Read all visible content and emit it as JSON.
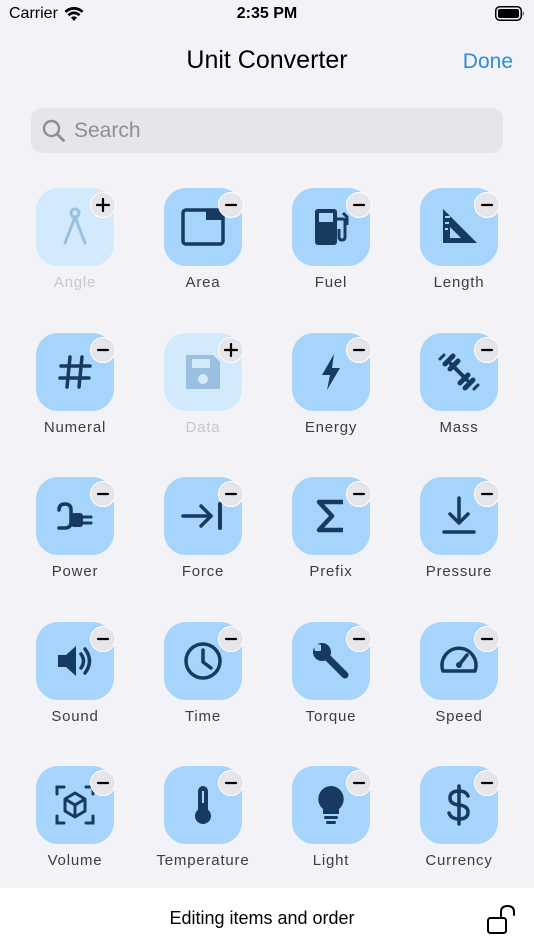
{
  "status_bar": {
    "carrier": "Carrier",
    "time": "2:35 PM"
  },
  "nav": {
    "title": "Unit Converter",
    "done_label": "Done"
  },
  "search": {
    "placeholder": "Search",
    "value": ""
  },
  "colors": {
    "accent": "#2a8de0",
    "tile": "#a6d4fb",
    "tile_disabled": "#d3e9fc",
    "icon": "#163b5e"
  },
  "items": [
    {
      "label": "Angle",
      "icon": "compass-icon",
      "state": "disabled",
      "badge": "add"
    },
    {
      "label": "Area",
      "icon": "area-icon",
      "state": "enabled",
      "badge": "remove"
    },
    {
      "label": "Fuel",
      "icon": "fuel-pump-icon",
      "state": "enabled",
      "badge": "remove"
    },
    {
      "label": "Length",
      "icon": "ruler-triangle-icon",
      "state": "enabled",
      "badge": "remove"
    },
    {
      "label": "Numeral",
      "icon": "hash-icon",
      "state": "enabled",
      "badge": "remove"
    },
    {
      "label": "Data",
      "icon": "floppy-disk-icon",
      "state": "disabled",
      "badge": "add"
    },
    {
      "label": "Energy",
      "icon": "bolt-icon",
      "state": "enabled",
      "badge": "remove"
    },
    {
      "label": "Mass",
      "icon": "dumbbell-icon",
      "state": "enabled",
      "badge": "remove"
    },
    {
      "label": "Power",
      "icon": "power-plug-icon",
      "state": "enabled",
      "badge": "remove"
    },
    {
      "label": "Force",
      "icon": "arrow-to-bar-icon",
      "state": "enabled",
      "badge": "remove"
    },
    {
      "label": "Prefix",
      "icon": "sigma-icon",
      "state": "enabled",
      "badge": "remove"
    },
    {
      "label": "Pressure",
      "icon": "arrow-down-to-line-icon",
      "state": "enabled",
      "badge": "remove"
    },
    {
      "label": "Sound",
      "icon": "speaker-icon",
      "state": "enabled",
      "badge": "remove"
    },
    {
      "label": "Time",
      "icon": "clock-icon",
      "state": "enabled",
      "badge": "remove"
    },
    {
      "label": "Torque",
      "icon": "wrench-icon",
      "state": "enabled",
      "badge": "remove"
    },
    {
      "label": "Speed",
      "icon": "speedometer-icon",
      "state": "enabled",
      "badge": "remove"
    },
    {
      "label": "Volume",
      "icon": "cube-icon",
      "state": "enabled",
      "badge": "remove"
    },
    {
      "label": "Temperature",
      "icon": "thermometer-icon",
      "state": "enabled",
      "badge": "remove"
    },
    {
      "label": "Light",
      "icon": "lightbulb-icon",
      "state": "enabled",
      "badge": "remove"
    },
    {
      "label": "Currency",
      "icon": "dollar-icon",
      "state": "enabled",
      "badge": "remove"
    }
  ],
  "footer": {
    "text": "Editing items and order",
    "icon": "unlock-icon"
  }
}
